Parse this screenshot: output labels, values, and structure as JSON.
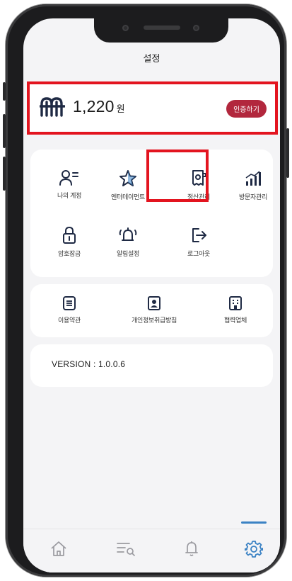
{
  "header": {
    "title": "설정"
  },
  "points": {
    "value": "1,220",
    "unit": "원",
    "certify_label": "인증하기"
  },
  "menu": [
    {
      "key": "account",
      "label": "나의 계정",
      "icon": "user-list-icon"
    },
    {
      "key": "entertainment",
      "label": "엔터테이먼트",
      "icon": "star-icon"
    },
    {
      "key": "settlement",
      "label": "정산관리",
      "icon": "receipt-icon"
    },
    {
      "key": "visitors",
      "label": "방문자관리",
      "icon": "bar-chart-icon"
    },
    {
      "key": "password",
      "label": "암호잠금",
      "icon": "lock-icon"
    },
    {
      "key": "alarm",
      "label": "알림설정",
      "icon": "bell-ringing-icon"
    },
    {
      "key": "logout",
      "label": "로그아웃",
      "icon": "logout-icon"
    }
  ],
  "policies": [
    {
      "key": "terms",
      "label": "이용약관",
      "icon": "document-lines-icon"
    },
    {
      "key": "privacy",
      "label": "개인정보취급방침",
      "icon": "person-card-icon"
    },
    {
      "key": "partners",
      "label": "협력업체",
      "icon": "building-icon"
    }
  ],
  "version": {
    "text": "VERSION : 1.0.0.6"
  },
  "tabbar": [
    {
      "key": "home",
      "icon": "home-icon"
    },
    {
      "key": "list",
      "icon": "list-search-icon"
    },
    {
      "key": "notifications",
      "icon": "bell-icon"
    },
    {
      "key": "settings",
      "icon": "gear-icon",
      "active": true
    }
  ],
  "colors": {
    "highlight": "#e3141f",
    "certify_button": "#b2273d",
    "accent": "#3b82c4",
    "icon": "#1f2a44"
  }
}
